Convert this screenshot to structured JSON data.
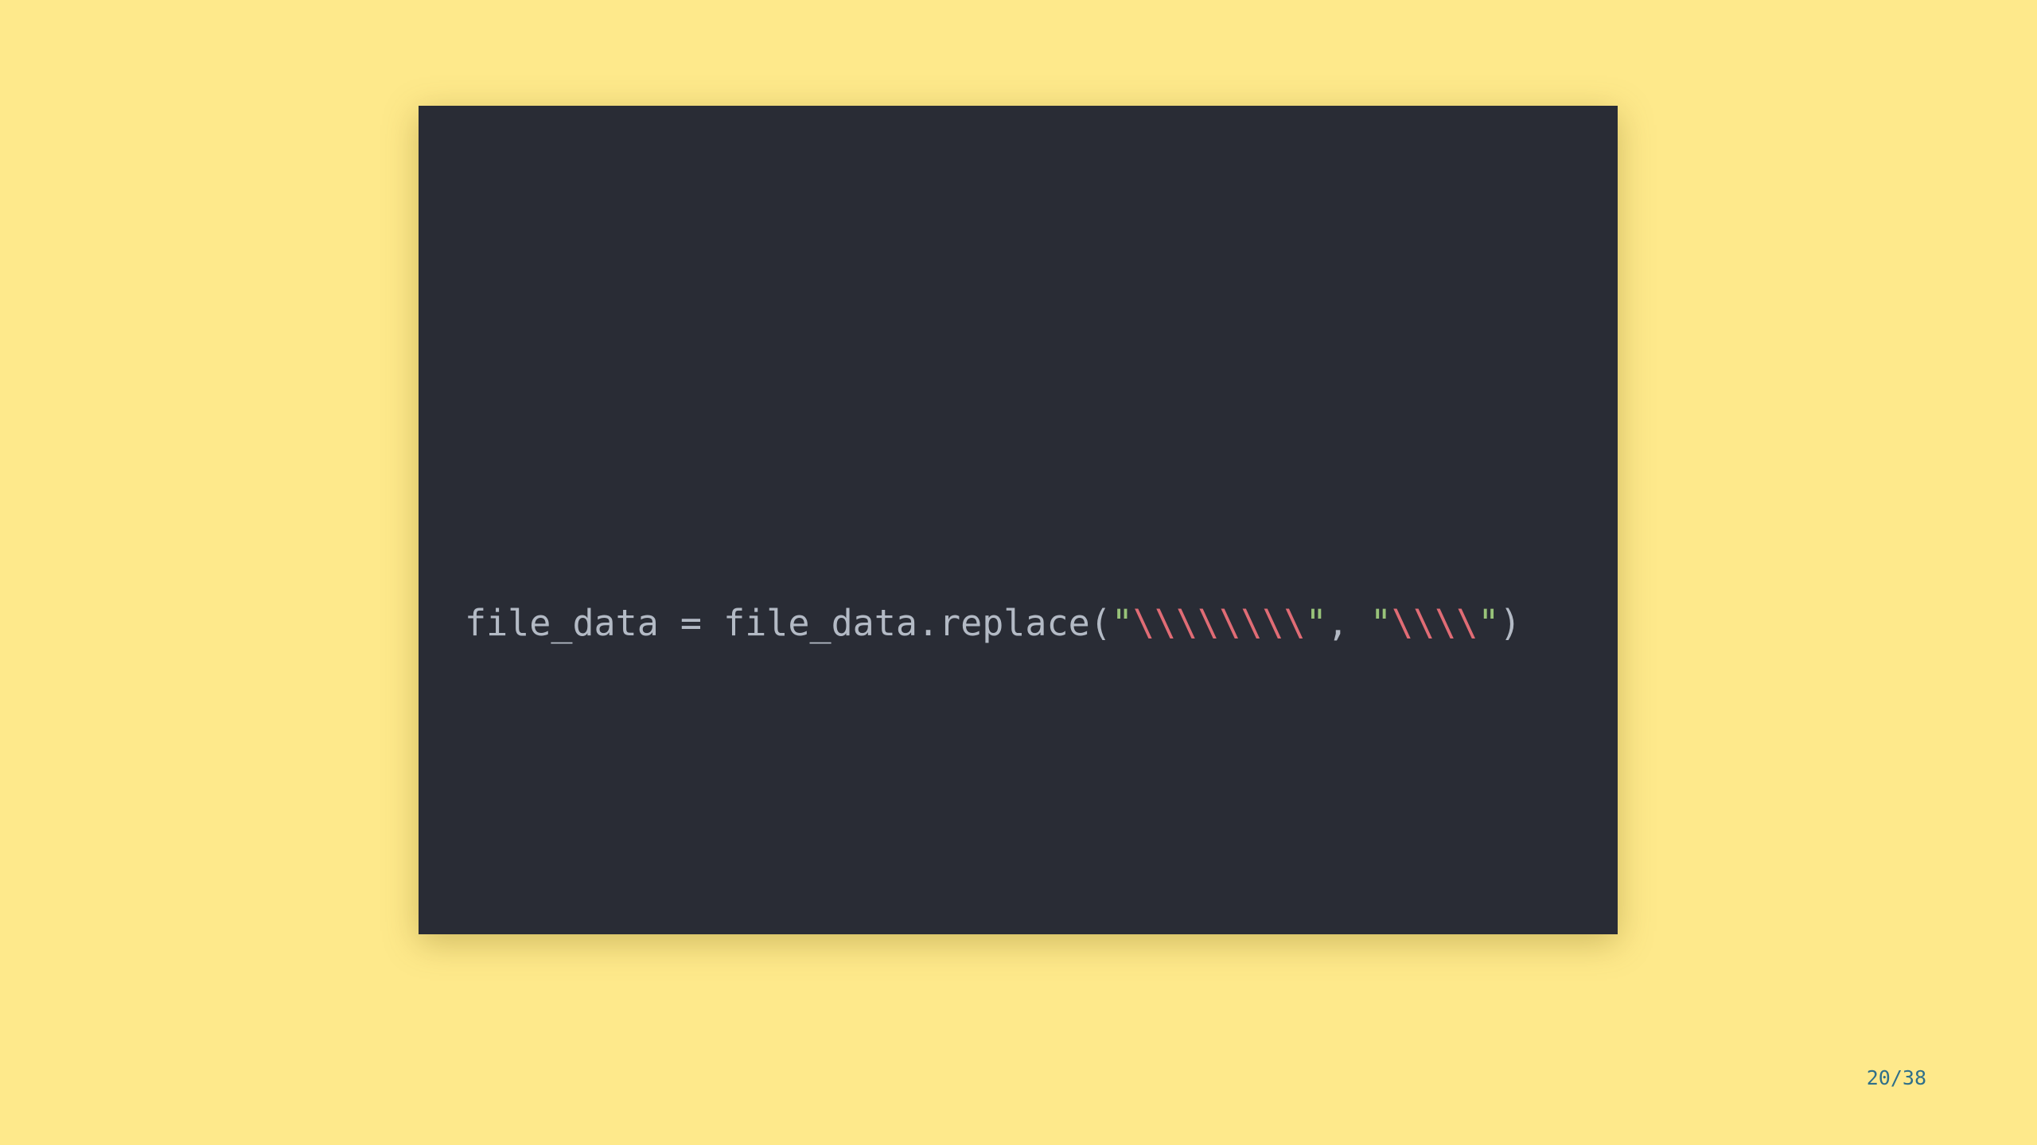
{
  "colors": {
    "background": "#fee98b",
    "panel": "#292c35",
    "code_default": "#b3bac5",
    "string_quote": "#98c379",
    "escape": "#e06c75",
    "counter": "#2f6f8a"
  },
  "code": {
    "tokens": [
      {
        "text": "file_data = file_data.replace(",
        "kind": "plain"
      },
      {
        "text": "\"",
        "kind": "quote"
      },
      {
        "text": "\\\\\\\\\\\\\\\\",
        "kind": "escape"
      },
      {
        "text": "\"",
        "kind": "quote"
      },
      {
        "text": ", ",
        "kind": "plain"
      },
      {
        "text": "\"",
        "kind": "quote"
      },
      {
        "text": "\\\\\\\\",
        "kind": "escape"
      },
      {
        "text": "\"",
        "kind": "quote"
      },
      {
        "text": ")",
        "kind": "plain"
      }
    ]
  },
  "footer": {
    "page_counter": "20/38"
  }
}
